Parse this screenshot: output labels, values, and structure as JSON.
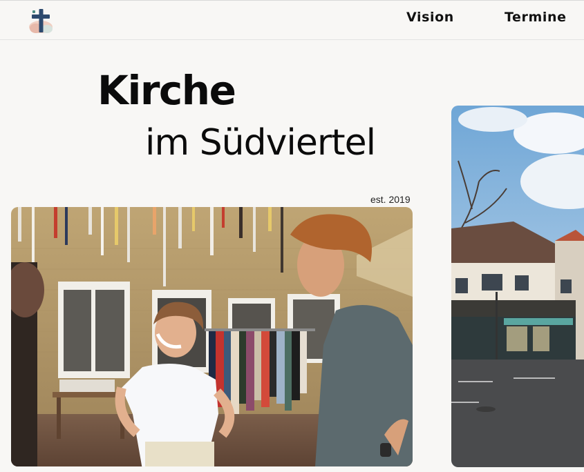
{
  "header": {
    "logo_icon": "cross-logo-icon",
    "nav": [
      {
        "label": "Vision"
      },
      {
        "label": "Termine"
      }
    ]
  },
  "hero": {
    "title_bold": "Kirche",
    "title_light": "im Südviertel",
    "established": "est. 2019"
  },
  "images": {
    "main_photo_icon": "people-laughing-flea-market-photo",
    "side_photo_icon": "street-corner-building-photo"
  },
  "colors": {
    "background": "#f8f7f5",
    "text": "#0d0d0d",
    "logo_blue": "#2d4a6e",
    "logo_green": "#4e8b83"
  }
}
